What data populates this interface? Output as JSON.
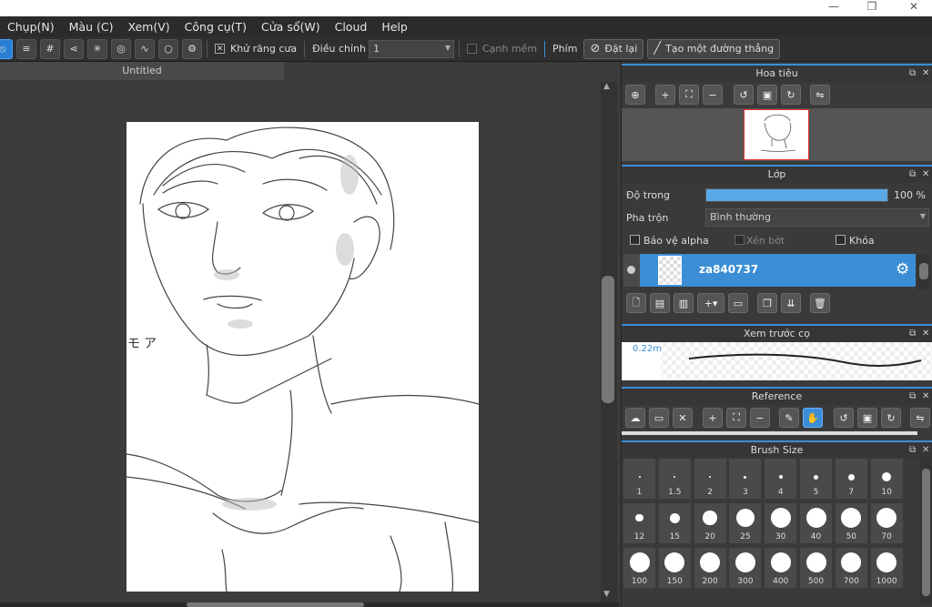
{
  "window": {
    "minimize": "—",
    "restore": "❐",
    "close": "✕"
  },
  "menu": [
    "Chụp(N)",
    "Màu (C)",
    "Xem(V)",
    "Công cụ(T)",
    "Cửa sổ(W)",
    "Cloud",
    "Help"
  ],
  "toolbar": {
    "antialias_label": "Khử răng cưa",
    "adjust_label": "Điều chỉnh",
    "adjust_value": "1",
    "soft_edge_label": "Cạnh mềm",
    "key_label": "Phím",
    "reset_label": "Đặt lại",
    "line_label": "Tạo một đường thẳng"
  },
  "document": {
    "tab_title": "Untitled",
    "canvas_text": "モア"
  },
  "navigator": {
    "title": "Hoa tiêu"
  },
  "layers": {
    "title": "Lớp",
    "opacity_label": "Độ trong",
    "opacity_value": "100 %",
    "opacity_fraction": 1.0,
    "blend_label": "Pha trộn",
    "blend_value": "Bình thường",
    "protect_alpha": "Bảo vệ alpha",
    "clipping": "Xén bớt",
    "lock": "Khóa",
    "layer_name": "za840737"
  },
  "brush_preview": {
    "title": "Xem trước cọ",
    "size_label": "0.22m"
  },
  "reference": {
    "title": "Reference"
  },
  "brush_size": {
    "title": "Brush Size",
    "sizes": [
      "1",
      "1.5",
      "2",
      "3",
      "4",
      "5",
      "7",
      "10",
      "12",
      "15",
      "20",
      "25",
      "30",
      "40",
      "50",
      "70",
      "100",
      "150",
      "200",
      "300",
      "400",
      "500",
      "700",
      "1000"
    ]
  },
  "colors": {
    "accent": "#3b8ed6",
    "panel": "#3a3a3a",
    "canvas_bg": "#3c3c3c"
  }
}
